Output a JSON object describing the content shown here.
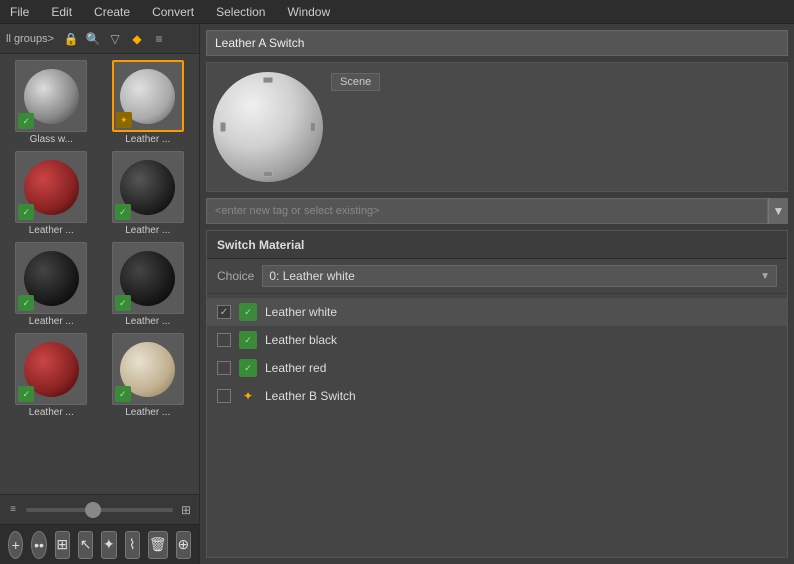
{
  "menubar": {
    "items": [
      "File",
      "Edit",
      "Create",
      "Convert",
      "Selection",
      "Window"
    ]
  },
  "left_panel": {
    "toolbar": {
      "groups_label": "ll groups>",
      "icons": [
        "lock",
        "search",
        "filter",
        "folder",
        "list"
      ]
    },
    "materials": [
      {
        "id": "glass-w",
        "label": "Glass w...",
        "type": "glass",
        "badge": "green"
      },
      {
        "id": "leather-white-thumb",
        "label": "Leather ...",
        "type": "leather-white",
        "badge": "orange",
        "selected": true
      },
      {
        "id": "leather-red-thumb",
        "label": "Leather ...",
        "type": "leather-red",
        "badge": "green"
      },
      {
        "id": "leather-black-thumb",
        "label": "Leather ...",
        "type": "leather-black",
        "badge": "green"
      },
      {
        "id": "leather-dark1",
        "label": "Leather ...",
        "type": "leather-dark",
        "badge": "green"
      },
      {
        "id": "leather-dark2",
        "label": "Leather ...",
        "type": "leather-dark",
        "badge": "green"
      },
      {
        "id": "leather-red2",
        "label": "Leather ...",
        "type": "leather-red",
        "badge": "green"
      },
      {
        "id": "leather-cream",
        "label": "Leather ...",
        "type": "leather-cream",
        "badge": "green"
      }
    ]
  },
  "right_panel": {
    "name": "Leather A Switch",
    "scene_tag": "Scene",
    "tag_placeholder": "<enter new tag or select existing>",
    "switch_material": {
      "title": "Switch Material",
      "choice_label": "Choice",
      "choice_value": "0: Leather white",
      "items": [
        {
          "id": "lw",
          "checked": true,
          "icon": "v",
          "icon_type": "green",
          "name": "Leather white"
        },
        {
          "id": "lb",
          "checked": false,
          "icon": "v",
          "icon_type": "green",
          "name": "Leather black"
        },
        {
          "id": "lr",
          "checked": false,
          "icon": "v",
          "icon_type": "green",
          "name": "Leather red"
        },
        {
          "id": "lbs",
          "checked": false,
          "icon": "✦",
          "icon_type": "orange",
          "name": "Leather B Switch"
        }
      ]
    }
  },
  "bottom_toolbar": {
    "buttons": [
      {
        "id": "add",
        "label": "+",
        "type": "circle"
      },
      {
        "id": "dots",
        "label": "••",
        "type": "circle"
      },
      {
        "id": "grid",
        "label": "⊞",
        "type": "rect"
      },
      {
        "id": "cursor",
        "label": "↖",
        "type": "rect"
      },
      {
        "id": "paint",
        "label": "✦",
        "type": "rect"
      },
      {
        "id": "brush",
        "label": "⌇",
        "type": "rect"
      },
      {
        "id": "delete",
        "label": "🗑",
        "type": "rect"
      },
      {
        "id": "nodes",
        "label": "⊕",
        "type": "rect"
      }
    ]
  }
}
